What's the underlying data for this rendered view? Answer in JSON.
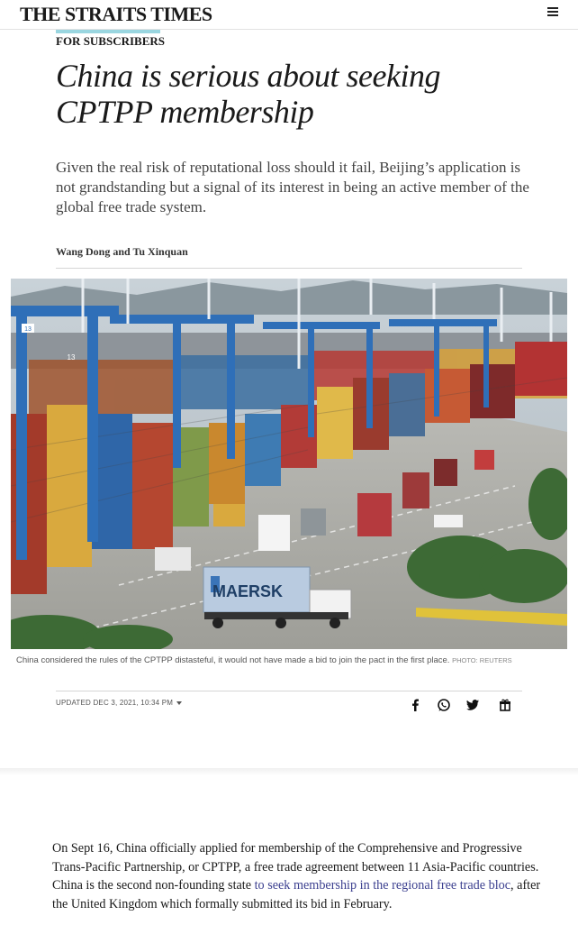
{
  "header": {
    "logo": "THE STRAITS TIMES",
    "menu_icon": "hamburger-menu-icon"
  },
  "article": {
    "kicker": "FOR SUBSCRIBERS",
    "title": "China is serious about seeking CPTPP membership",
    "standfirst": "Given the real risk of reputational loss should it fail, Beijing’s application is not grandstanding but a signal of its interest in being an active member of the global free trade system.",
    "byline": "Wang Dong and Tu Xinquan",
    "image": {
      "crane_label_1": "13",
      "crane_label_2": "13",
      "truck_brand": "MAERSK"
    },
    "caption": "China considered the rules of the CPTPP distasteful, it would not have made a bid to join the pact in the first place.",
    "photo_credit": "PHOTO: REUTERS",
    "updated": "UPDATED  DEC 3, 2021, 10:34 PM",
    "share_icons": [
      "facebook-icon",
      "whatsapp-icon",
      "twitter-icon",
      "gift-icon"
    ],
    "body": {
      "text_1": "On Sept 16, China officially applied for membership of the Comprehensive and Progressive Trans-Pacific Partnership, or CPTPP, a free trade agreement between 11 Asia-Pacific countries. China is the second non-founding state ",
      "link": "to seek membership in the regional free trade bloc",
      "text_2": ", after the United Kingdom which formally submitted its bid in February."
    }
  },
  "colors": {
    "accent": "#9ad6e0",
    "link": "#3b3f8f",
    "text": "#1a1a1a",
    "crane_blue": "#2f6fb8"
  }
}
